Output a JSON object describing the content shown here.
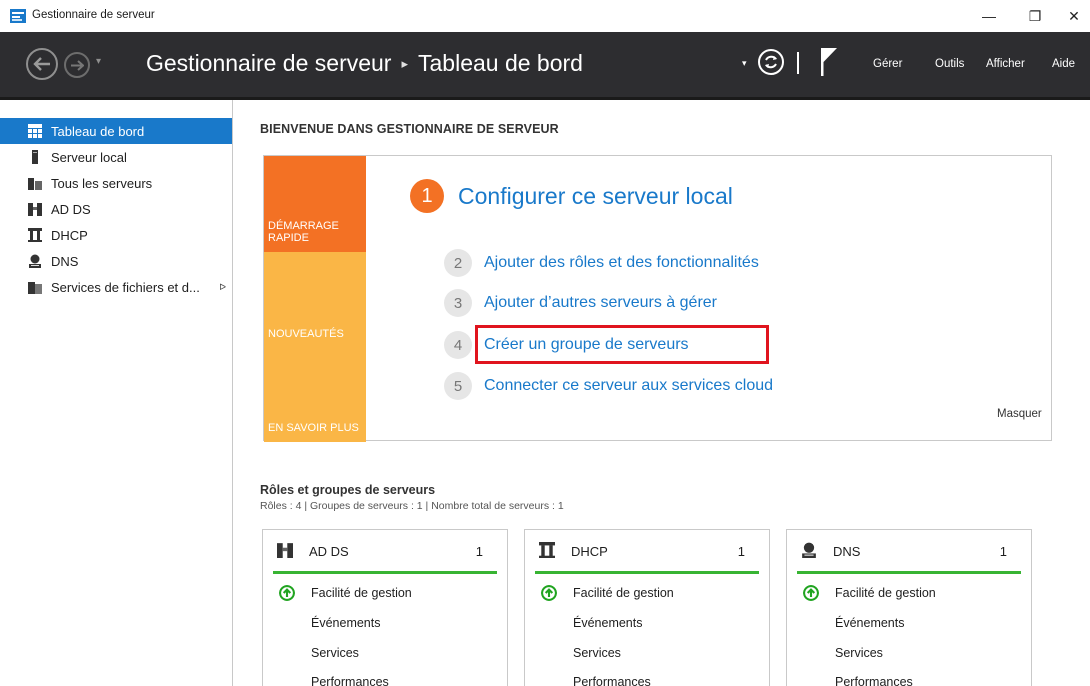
{
  "window": {
    "title": "Gestionnaire de serveur",
    "controls": {
      "minimize": "—",
      "maximize": "❐",
      "close": "✕"
    }
  },
  "header": {
    "app_name": "Gestionnaire de serveur",
    "separator": "▸",
    "page": "Tableau de bord",
    "dropdown_glyph": "▾",
    "menu": [
      "Gérer",
      "Outils",
      "Afficher",
      "Aide"
    ]
  },
  "sidebar": {
    "items": [
      {
        "label": "Tableau de bord",
        "icon": "dashboard-icon",
        "active": true
      },
      {
        "label": "Serveur local",
        "icon": "server-icon",
        "active": false
      },
      {
        "label": "Tous les serveurs",
        "icon": "servers-icon",
        "active": false
      },
      {
        "label": "AD DS",
        "icon": "ad-ds-icon",
        "active": false
      },
      {
        "label": "DHCP",
        "icon": "dhcp-icon",
        "active": false
      },
      {
        "label": "DNS",
        "icon": "dns-icon",
        "active": false
      },
      {
        "label": "Services de fichiers et d...",
        "icon": "file-services-icon",
        "active": false,
        "expand": "ᐅ"
      }
    ]
  },
  "main": {
    "welcome": "BIENVENUE DANS GESTIONNAIRE DE SERVEUR",
    "quickstart": {
      "tabs": [
        "DÉMARRAGE RAPIDE",
        "NOUVEAUTÉS",
        "EN SAVOIR PLUS"
      ],
      "step1": {
        "num": "1",
        "label": "Configurer ce serveur local"
      },
      "steps": [
        {
          "num": "2",
          "label": "Ajouter des rôles et des fonctionnalités"
        },
        {
          "num": "3",
          "label": "Ajouter d’autres serveurs à gérer"
        },
        {
          "num": "4",
          "label": "Créer un groupe de serveurs"
        },
        {
          "num": "5",
          "label": "Connecter ce serveur aux services cloud"
        }
      ],
      "hide": "Masquer"
    },
    "roles": {
      "title": "Rôles et groupes de serveurs",
      "summary": "Rôles : 4   |   Groupes de serveurs : 1   |   Nombre total de serveurs : 1",
      "cards": [
        {
          "name": "AD DS",
          "count": "1",
          "icon": "ad-ds-icon",
          "rows": [
            "Facilité de gestion",
            "Événements",
            "Services",
            "Performances"
          ]
        },
        {
          "name": "DHCP",
          "count": "1",
          "icon": "dhcp-icon",
          "rows": [
            "Facilité de gestion",
            "Événements",
            "Services",
            "Performances"
          ]
        },
        {
          "name": "DNS",
          "count": "1",
          "icon": "dns-icon",
          "rows": [
            "Facilité de gestion",
            "Événements",
            "Services",
            "Performances"
          ]
        }
      ]
    }
  },
  "colors": {
    "header_bg": "#2d2d30",
    "accent_blue": "#1979ca",
    "orange": "#f37124",
    "light_orange": "#fab646",
    "highlight_red": "#e0141e",
    "status_green": "#38b433"
  }
}
